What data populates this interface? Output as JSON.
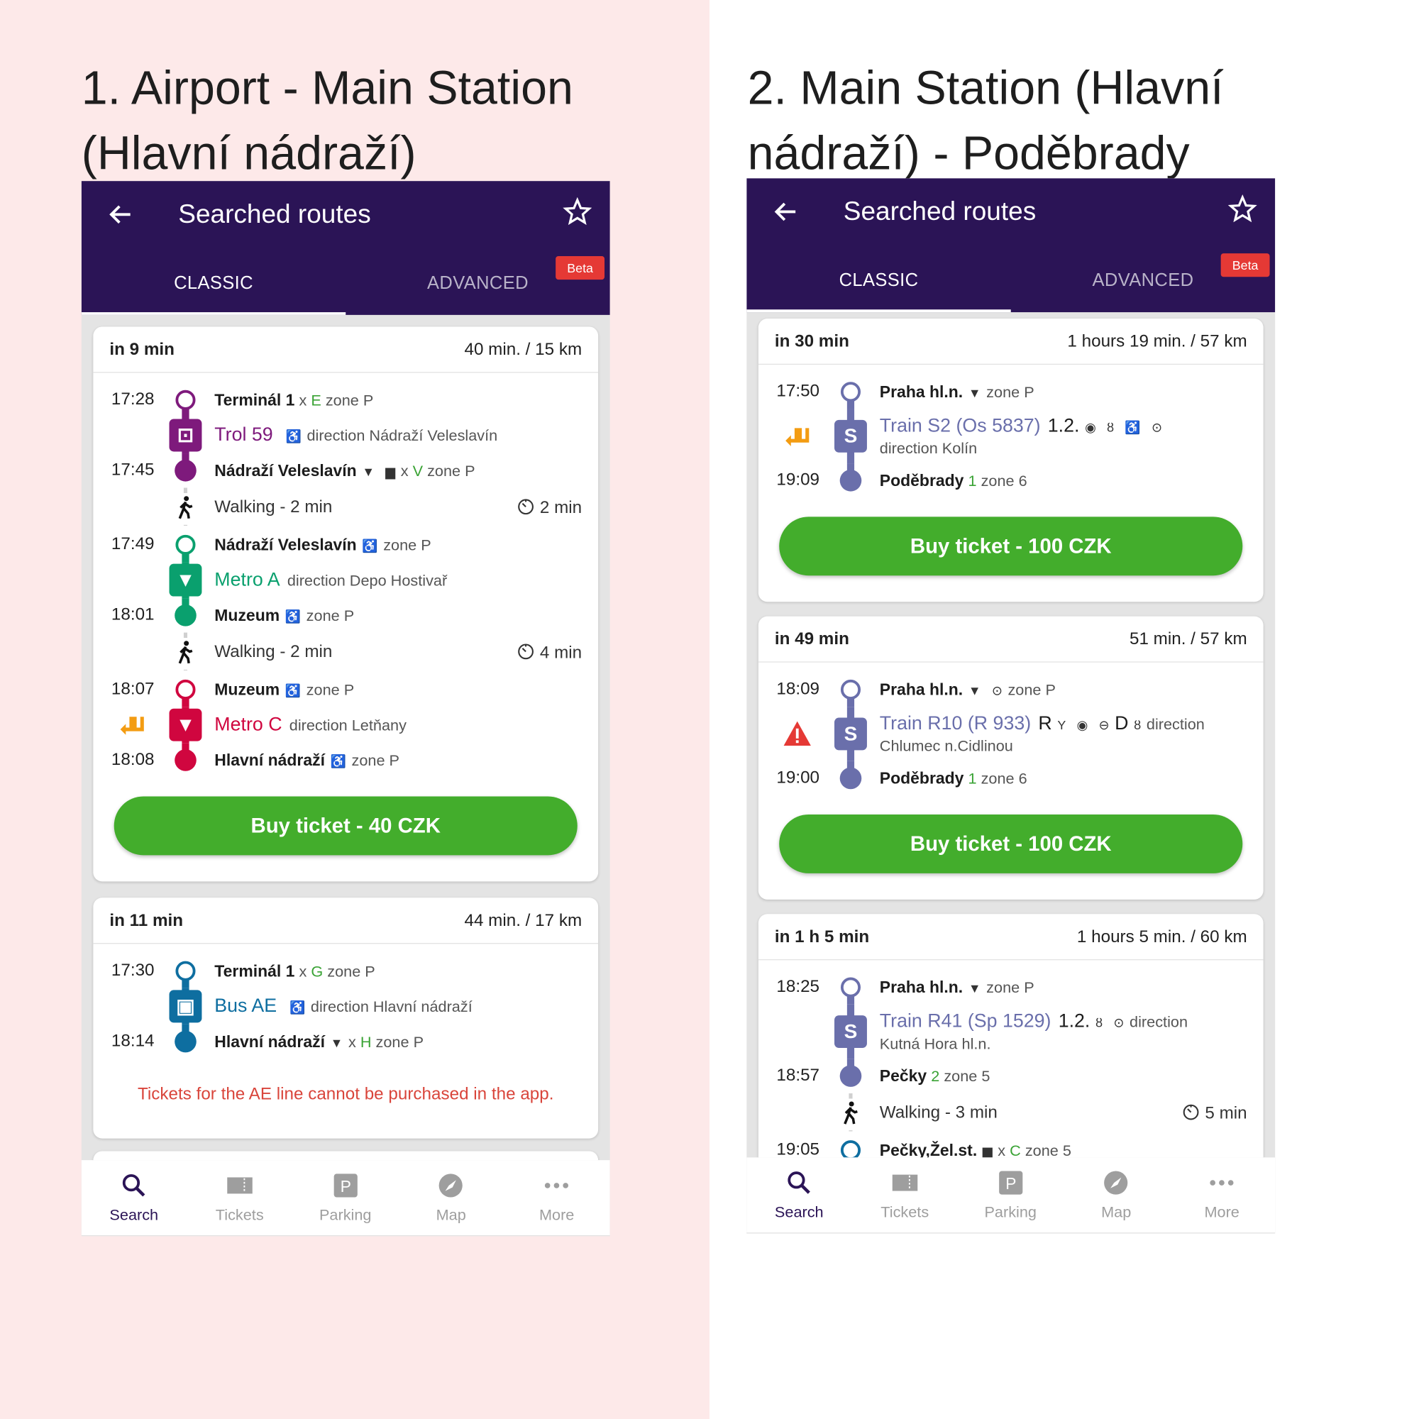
{
  "panels": [
    {
      "heading": [
        "1. Airport - Main Station",
        "(Hlavní nádraží)"
      ],
      "app": {
        "title": "Searched routes",
        "tabs": [
          "CLASSIC",
          "ADVANCED"
        ],
        "active_tab": "CLASSIC",
        "beta": "Beta"
      },
      "cards": [
        {
          "when": "in 9 min",
          "summary": "40 min. / 15 km",
          "button": "Buy ticket - 40 CZK",
          "rows": [
            {
              "k": "stop",
              "pos": "start",
              "time": "17:28",
              "color": "#7e1a7c",
              "parts": [
                {
                  "t": "Terminál 1",
                  "s": "b"
                },
                {
                  "t": " x ",
                  "s": "n"
                },
                {
                  "t": "E",
                  "s": "g"
                },
                {
                  "t": " zone P",
                  "s": "n"
                }
              ]
            },
            {
              "k": "line",
              "color": "#7e1a7c",
              "icon": "trolleybus-icon",
              "name": "Trol 59",
              "parts": [
                {
                  "icon": "wheelchair-icon"
                },
                {
                  "t": "direction Nádraží Veleslavín",
                  "s": "n"
                }
              ]
            },
            {
              "k": "stop",
              "pos": "end",
              "time": "17:45",
              "color": "#7e1a7c",
              "parts": [
                {
                  "t": "Nádraží Veleslavín",
                  "s": "b"
                },
                {
                  "icon": "metro-icon"
                },
                {
                  "icon": "train-icon"
                },
                {
                  "t": "x ",
                  "s": "n"
                },
                {
                  "t": "V",
                  "s": "g"
                },
                {
                  "t": " zone P",
                  "s": "n"
                }
              ]
            },
            {
              "k": "walk",
              "text": "Walking - 2 min",
              "dur": "2 min"
            },
            {
              "k": "stop",
              "pos": "start",
              "time": "17:49",
              "color": "#0aa06e",
              "parts": [
                {
                  "t": "Nádraží Veleslavín",
                  "s": "b"
                },
                {
                  "icon": "wheelchair-icon"
                },
                {
                  "t": "zone P",
                  "s": "n"
                }
              ]
            },
            {
              "k": "line",
              "color": "#0aa06e",
              "icon": "metro-icon",
              "name": "Metro A",
              "parts": [
                {
                  "t": "direction Depo Hostivař",
                  "s": "n"
                }
              ]
            },
            {
              "k": "stop",
              "pos": "end",
              "time": "18:01",
              "color": "#0aa06e",
              "parts": [
                {
                  "t": "Muzeum",
                  "s": "b"
                },
                {
                  "icon": "wheelchair-icon"
                },
                {
                  "t": "zone P",
                  "s": "n"
                }
              ]
            },
            {
              "k": "walk",
              "text": "Walking - 2 min",
              "dur": "4 min"
            },
            {
              "k": "stop",
              "pos": "start",
              "time": "18:07",
              "color": "#d0063f",
              "parts": [
                {
                  "t": "Muzeum",
                  "s": "b"
                },
                {
                  "icon": "wheelchair-icon"
                },
                {
                  "t": "zone P",
                  "s": "n"
                }
              ]
            },
            {
              "k": "line",
              "color": "#d0063f",
              "icon": "metro-icon",
              "name": "Metro C",
              "left": "transfer-icon",
              "parts": [
                {
                  "t": "direction Letňany",
                  "s": "n"
                }
              ]
            },
            {
              "k": "stop",
              "pos": "end",
              "time": "18:08",
              "color": "#d0063f",
              "parts": [
                {
                  "t": "Hlavní nádraží",
                  "s": "b"
                },
                {
                  "icon": "wheelchair-icon"
                },
                {
                  "t": "zone P",
                  "s": "n"
                }
              ]
            }
          ]
        },
        {
          "when": "in 11 min",
          "summary": "44 min. / 17 km",
          "note": "Tickets for the AE line cannot be purchased in the app.",
          "rows": [
            {
              "k": "stop",
              "pos": "start",
              "time": "17:30",
              "color": "#0e6ea0",
              "parts": [
                {
                  "t": "Terminál 1",
                  "s": "b"
                },
                {
                  "t": " x ",
                  "s": "n"
                },
                {
                  "t": "G",
                  "s": "g"
                },
                {
                  "t": " zone P",
                  "s": "n"
                }
              ]
            },
            {
              "k": "line",
              "color": "#0e6ea0",
              "icon": "bus-icon",
              "name": "Bus AE",
              "parts": [
                {
                  "icon": "wheelchair-icon"
                },
                {
                  "t": "direction Hlavní nádraží",
                  "s": "n"
                }
              ]
            },
            {
              "k": "stop",
              "pos": "end",
              "time": "18:14",
              "color": "#0e6ea0",
              "parts": [
                {
                  "t": "Hlavní nádraží",
                  "s": "b"
                },
                {
                  "icon": "metro-icon"
                },
                {
                  "t": "x ",
                  "s": "n"
                },
                {
                  "t": "H",
                  "s": "g"
                },
                {
                  "t": " zone P",
                  "s": "n"
                }
              ]
            }
          ]
        }
      ],
      "nav": [
        {
          "label": "Search",
          "icon": "search-icon",
          "active": true
        },
        {
          "label": "Tickets",
          "icon": "ticket-icon"
        },
        {
          "label": "Parking",
          "icon": "parking-icon"
        },
        {
          "label": "Map",
          "icon": "compass-icon"
        },
        {
          "label": "More",
          "icon": "more-icon"
        }
      ]
    },
    {
      "heading": [
        "2. Main Station (Hlavní",
        "nádraží) - Poděbrady"
      ],
      "app": {
        "title": "Searched routes",
        "tabs": [
          "CLASSIC",
          "ADVANCED"
        ],
        "active_tab": "CLASSIC",
        "beta": "Beta"
      },
      "cards": [
        {
          "when": "in 30 min",
          "summary": "1 hours 19 min. / 57 km",
          "button": "Buy ticket - 100 CZK",
          "rows": [
            {
              "k": "stop",
              "pos": "start",
              "time": "17:50",
              "color": "#6a6fab",
              "parts": [
                {
                  "t": "Praha hl.n.",
                  "s": "b"
                },
                {
                  "icon": "metro-icon"
                },
                {
                  "t": "zone P",
                  "s": "n"
                }
              ]
            },
            {
              "k": "line",
              "color": "#6a6fab",
              "icon": "train-s-icon",
              "name": "Train S2 (Os 5837)",
              "left": "transfer-icon",
              "sub": "direction Kolín",
              "parts": [
                {
                  "t": "1.2.",
                  "s": "k"
                },
                {
                  "icon": "wifi-icon"
                },
                {
                  "icon": "bicycle-icon"
                },
                {
                  "icon": "wheelchair-icon"
                },
                {
                  "icon": "target-icon"
                }
              ]
            },
            {
              "k": "stop",
              "pos": "end",
              "time": "19:09",
              "color": "#6a6fab",
              "parts": [
                {
                  "t": "Poděbrady",
                  "s": "b"
                },
                {
                  "t": " 1",
                  "s": "g"
                },
                {
                  "t": " zone 6",
                  "s": "n"
                }
              ]
            }
          ]
        },
        {
          "when": "in 49 min",
          "summary": "51 min. / 57 km",
          "button": "Buy ticket - 100 CZK",
          "rows": [
            {
              "k": "stop",
              "pos": "start",
              "time": "18:09",
              "color": "#6a6fab",
              "parts": [
                {
                  "t": "Praha hl.n.",
                  "s": "b"
                },
                {
                  "icon": "metro-icon"
                },
                {
                  "icon": "target-icon"
                },
                {
                  "t": "zone P",
                  "s": "n"
                }
              ]
            },
            {
              "k": "line",
              "color": "#6a6fab",
              "icon": "train-s-icon",
              "name": "Train R10 (R 933)",
              "left": "warning-icon",
              "sub": "Chlumec n.Cidlinou",
              "parts": [
                {
                  "t": "R",
                  "s": "k"
                },
                {
                  "icon": "restaurant-icon"
                },
                {
                  "icon": "wifi-icon"
                },
                {
                  "icon": "socket-icon"
                },
                {
                  "t": "D",
                  "s": "k"
                },
                {
                  "icon": "bicycle-icon"
                },
                {
                  "t": "direction",
                  "s": "n"
                }
              ]
            },
            {
              "k": "stop",
              "pos": "end",
              "time": "19:00",
              "color": "#6a6fab",
              "parts": [
                {
                  "t": "Poděbrady",
                  "s": "b"
                },
                {
                  "t": " 1",
                  "s": "g"
                },
                {
                  "t": " zone 6",
                  "s": "n"
                }
              ]
            }
          ]
        },
        {
          "when": "in 1 h 5 min",
          "summary": "1 hours 5 min. / 60 km",
          "rows": [
            {
              "k": "stop",
              "pos": "start",
              "time": "18:25",
              "color": "#6a6fab",
              "parts": [
                {
                  "t": "Praha hl.n.",
                  "s": "b"
                },
                {
                  "icon": "metro-icon"
                },
                {
                  "t": "zone P",
                  "s": "n"
                }
              ]
            },
            {
              "k": "line",
              "color": "#6a6fab",
              "icon": "train-s-icon",
              "name": "Train R41 (Sp 1529)",
              "sub": "Kutná Hora hl.n.",
              "parts": [
                {
                  "t": "1.2.",
                  "s": "k"
                },
                {
                  "icon": "bicycle-icon"
                },
                {
                  "icon": "target-icon"
                },
                {
                  "t": "direction",
                  "s": "n"
                }
              ]
            },
            {
              "k": "stop",
              "pos": "end",
              "time": "18:57",
              "color": "#6a6fab",
              "parts": [
                {
                  "t": "Pečky",
                  "s": "b"
                },
                {
                  "t": " 2",
                  "s": "g"
                },
                {
                  "t": " zone 5",
                  "s": "n"
                }
              ]
            },
            {
              "k": "walk",
              "text": "Walking - 3 min",
              "dur": "5 min"
            },
            {
              "k": "stop",
              "pos": "start",
              "time": "19:05",
              "color": "#0e6ea0",
              "parts": [
                {
                  "t": "Pečky,Žel.st.",
                  "s": "b"
                },
                {
                  "icon": "train-icon"
                },
                {
                  "t": "x ",
                  "s": "n"
                },
                {
                  "t": "C",
                  "s": "g"
                },
                {
                  "t": " zone 5",
                  "s": "n"
                }
              ]
            }
          ]
        }
      ],
      "nav": [
        {
          "label": "Search",
          "icon": "search-icon",
          "active": true
        },
        {
          "label": "Tickets",
          "icon": "ticket-icon"
        },
        {
          "label": "Parking",
          "icon": "parking-icon"
        },
        {
          "label": "Map",
          "icon": "compass-icon"
        },
        {
          "label": "More",
          "icon": "more-icon"
        }
      ]
    }
  ],
  "colors": {
    "appbar": "#2b1456",
    "buy_button": "#43ad2c",
    "beta": "#e53935",
    "note": "#d9453b",
    "left_background": "#fde9e9"
  }
}
